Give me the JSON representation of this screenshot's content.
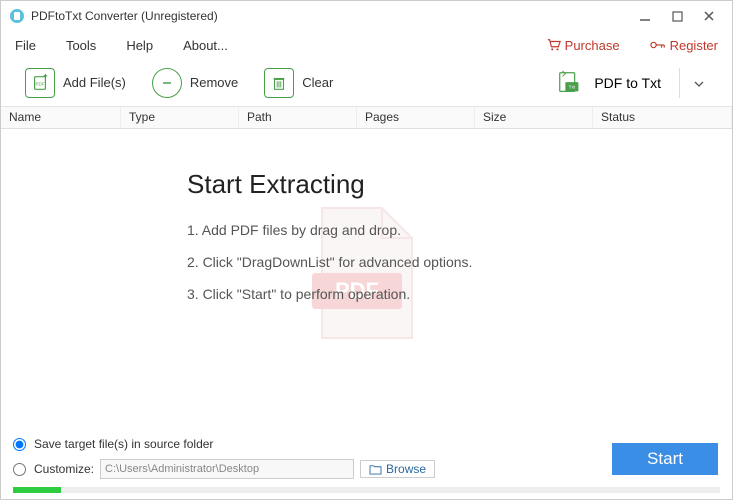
{
  "window": {
    "title": "PDFtoTxt Converter (Unregistered)"
  },
  "menu": {
    "file": "File",
    "tools": "Tools",
    "help": "Help",
    "about": "About...",
    "purchase": "Purchase",
    "register": "Register"
  },
  "toolbar": {
    "add": "Add File(s)",
    "remove": "Remove",
    "clear": "Clear",
    "convert": "PDF to Txt"
  },
  "columns": {
    "name": "Name",
    "type": "Type",
    "path": "Path",
    "pages": "Pages",
    "size": "Size",
    "status": "Status"
  },
  "instructions": {
    "heading": "Start Extracting",
    "step1": "1. Add PDF files by drag and drop.",
    "step2": "2. Click \"DragDownList\" for advanced options.",
    "step3": "3. Click \"Start\" to perform operation."
  },
  "output": {
    "save_source": "Save target file(s) in source folder",
    "customize": "Customize:",
    "path": "C:\\Users\\Administrator\\Desktop",
    "browse": "Browse"
  },
  "action": {
    "start": "Start"
  }
}
